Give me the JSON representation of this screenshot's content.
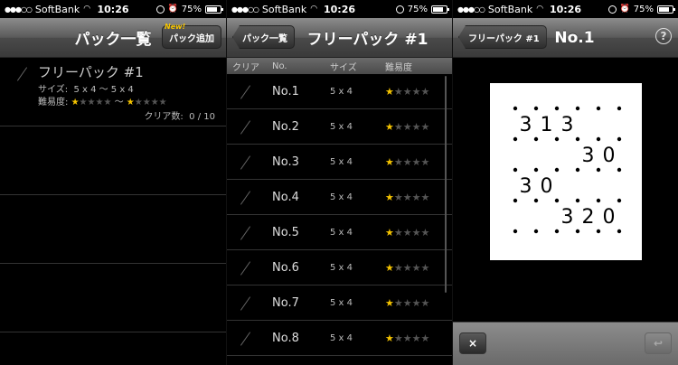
{
  "status": {
    "carrier": "SoftBank",
    "time": "10:26",
    "battery": "75%"
  },
  "screen1": {
    "title": "パック一覧",
    "add_button": "パック追加",
    "new_badge": "New!",
    "pack": {
      "name": "フリーパック #1",
      "size_label": "サイズ:",
      "size_value": "5 x 4 〜 5 x 4",
      "difficulty_label": "難易度:",
      "difficulty_min": 1,
      "difficulty_max": 1,
      "difficulty_sep": "〜",
      "clear_label": "クリア数:",
      "clear_value": "0 / 10"
    }
  },
  "screen2": {
    "back_button": "パック一覧",
    "title": "フリーパック #1",
    "columns": {
      "clear": "クリア",
      "no": "No.",
      "size": "サイズ",
      "difficulty": "難易度"
    },
    "rows": [
      {
        "no": "No.1",
        "size": "5 x 4",
        "stars": 1
      },
      {
        "no": "No.2",
        "size": "5 x 4",
        "stars": 1
      },
      {
        "no": "No.3",
        "size": "5 x 4",
        "stars": 1
      },
      {
        "no": "No.4",
        "size": "5 x 4",
        "stars": 1
      },
      {
        "no": "No.5",
        "size": "5 x 4",
        "stars": 1
      },
      {
        "no": "No.6",
        "size": "5 x 4",
        "stars": 1
      },
      {
        "no": "No.7",
        "size": "5 x 4",
        "stars": 1
      },
      {
        "no": "No.8",
        "size": "5 x 4",
        "stars": 1
      }
    ]
  },
  "screen3": {
    "back_button": "フリーパック #1",
    "title": "No.1",
    "help": "?",
    "puzzle": {
      "cols": 5,
      "rows": 4,
      "clues": [
        [
          "3",
          "1",
          "3",
          "",
          ""
        ],
        [
          "",
          "",
          "",
          "3",
          "0"
        ],
        [
          "3",
          "0",
          "",
          "",
          ""
        ],
        [
          "",
          "",
          "3",
          "2",
          "0"
        ]
      ]
    },
    "close_button": "×",
    "undo_button": "↩"
  },
  "colors": {
    "star_on": "#f5c400",
    "star_off": "#555555"
  }
}
